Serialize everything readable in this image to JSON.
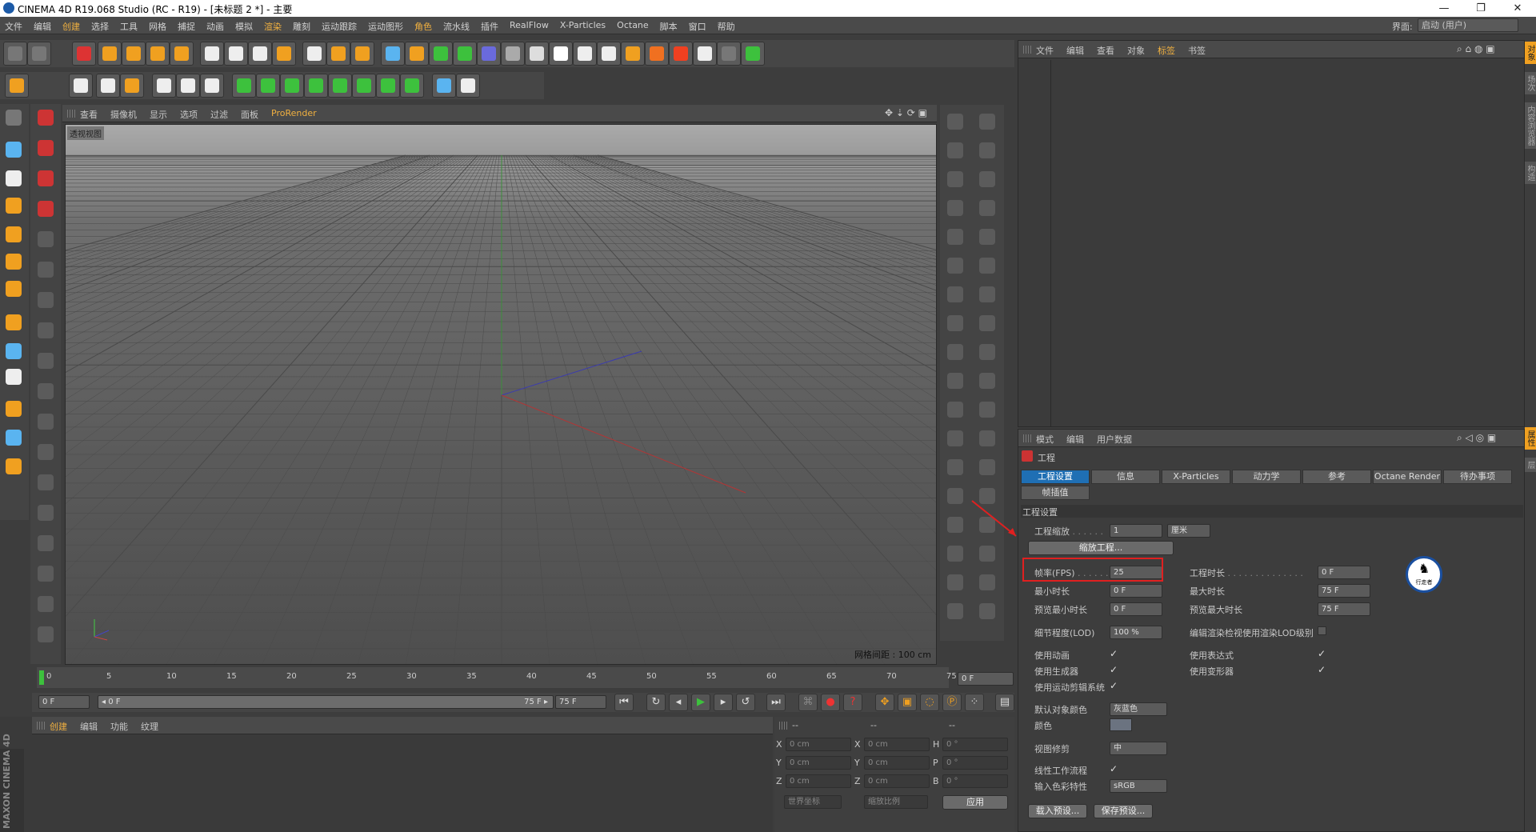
{
  "titlebar": {
    "title": "CINEMA 4D R19.068 Studio (RC - R19) - [未标题 2 *] - 主要",
    "min": "—",
    "max": "❐",
    "close": "✕"
  },
  "menubar": {
    "items": [
      "文件",
      "编辑",
      "创建",
      "选择",
      "工具",
      "网格",
      "捕捉",
      "动画",
      "模拟",
      "渲染",
      "雕刻",
      "运动跟踪",
      "运动图形",
      "角色",
      "流水线",
      "插件",
      "RealFlow",
      "X-Particles",
      "Octane",
      "脚本",
      "窗口",
      "帮助"
    ],
    "layout_label": "界面:",
    "layout_value": "启动 (用户)"
  },
  "viewport": {
    "menu": [
      "查看",
      "摄像机",
      "显示",
      "选项",
      "过滤",
      "面板",
      "ProRender"
    ],
    "label": "透视视图",
    "grid_spacing": "网格间距 : 100 cm"
  },
  "timeline": {
    "ticks": [
      "0",
      "5",
      "10",
      "15",
      "20",
      "25",
      "30",
      "35",
      "40",
      "45",
      "50",
      "55",
      "60",
      "65",
      "70",
      "75"
    ],
    "current": "0 F",
    "start": "0 F",
    "range_start": "◂ 0 F",
    "range_end": "75 F ▸",
    "end": "75 F"
  },
  "material": {
    "menu": [
      "创建",
      "编辑",
      "功能",
      "纹理"
    ],
    "brand": "MAXON CINEMA 4D"
  },
  "coords": {
    "headers": [
      "--",
      "--",
      "--"
    ],
    "rows": [
      {
        "a": "X",
        "v1": "0 cm",
        "b": "X",
        "v2": "0 cm",
        "c": "H",
        "v3": "0 °"
      },
      {
        "a": "Y",
        "v1": "0 cm",
        "b": "Y",
        "v2": "0 cm",
        "c": "P",
        "v3": "0 °"
      },
      {
        "a": "Z",
        "v1": "0 cm",
        "b": "Z",
        "v2": "0 cm",
        "c": "B",
        "v3": "0 °"
      }
    ],
    "world": "世界坐标",
    "scale": "缩放比例",
    "apply": "应用"
  },
  "objects": {
    "menu": [
      "文件",
      "编辑",
      "查看",
      "对象",
      "标签",
      "书签"
    ]
  },
  "attributes": {
    "menu": [
      "模式",
      "编辑",
      "用户数据"
    ],
    "title": "工程",
    "tabs": [
      "工程设置",
      "信息",
      "X-Particles",
      "动力学",
      "参考",
      "Octane Render",
      "待办事项"
    ],
    "tab2": "帧插值",
    "section": "工程设置",
    "scale_label": "工程缩放",
    "scale_value": "1",
    "scale_unit": "厘米",
    "scale_btn": "缩放工程...",
    "fps_label": "帧率(FPS)",
    "fps_value": "25",
    "duration_label": "工程时长",
    "duration_value": "0 F",
    "min_label": "最小时长",
    "min_value": "0 F",
    "max_label": "最大时长",
    "max_value": "75 F",
    "pmin_label": "预览最小时长",
    "pmin_value": "0 F",
    "pmax_label": "预览最大时长",
    "pmax_value": "75 F",
    "lod_label": "细节程度(LOD)",
    "lod_value": "100 %",
    "lod_check_label": "编辑渲染检视使用渲染LOD级别",
    "use_anim": "使用动画",
    "use_expr": "使用表达式",
    "use_gen": "使用生成器",
    "use_deform": "使用变形器",
    "use_mograph": "使用运动剪辑系统",
    "default_color_label": "默认对象颜色",
    "default_color_value": "灰蓝色",
    "color_label": "颜色",
    "clip_label": "视图修剪",
    "clip_value": "中",
    "linear_label": "线性工作流程",
    "input_color_label": "输入色彩特性",
    "input_color_value": "sRGB",
    "load_preset": "载入预设...",
    "save_preset": "保存预设...",
    "watermark": "行走者"
  },
  "right_tabs": [
    "对象",
    "场次",
    "内容浏览器",
    "构造"
  ],
  "right_tabs2": [
    "属性",
    "层"
  ]
}
